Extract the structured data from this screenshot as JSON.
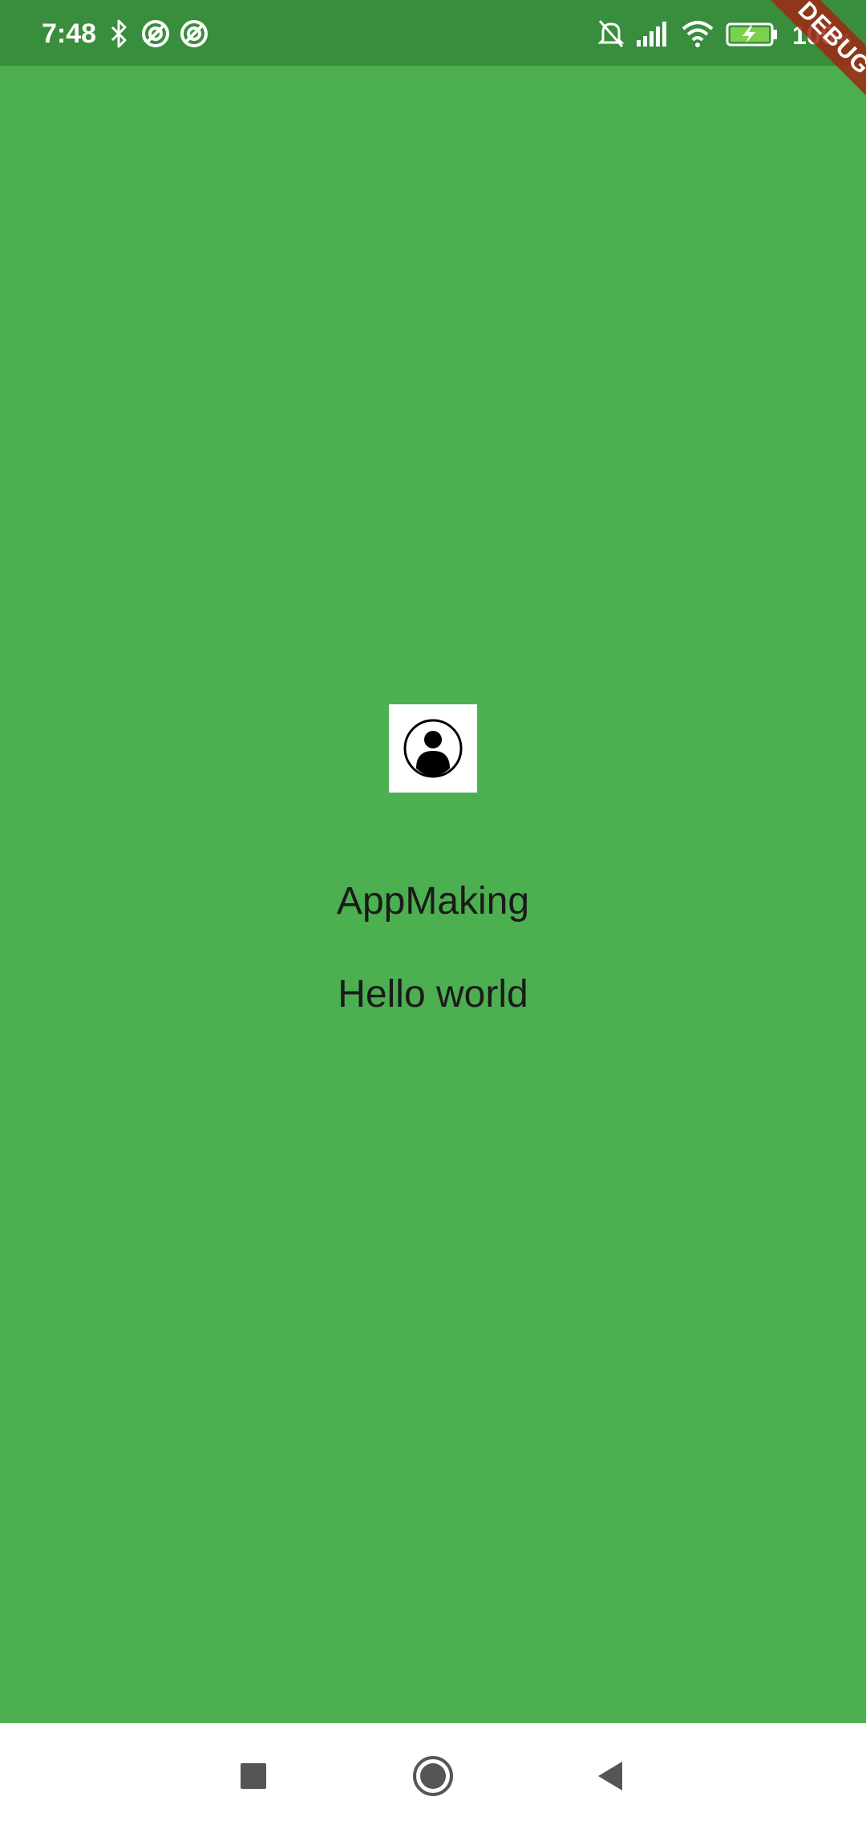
{
  "status_bar": {
    "time": "7:48",
    "battery_percent": "100",
    "battery_percent_sign": "%",
    "icons": [
      "bluetooth-icon",
      "sync-icon",
      "sync-icon",
      "bell-off-icon",
      "signal-icon",
      "wifi-icon",
      "battery-charging-icon"
    ]
  },
  "debug_banner": {
    "label": "DEBUG"
  },
  "main": {
    "avatar_icon": "account-circle-icon",
    "title": "AppMaking",
    "subtitle": "Hello world"
  },
  "nav_bar": {
    "buttons": [
      "recents-button",
      "home-button",
      "back-button"
    ]
  },
  "colors": {
    "background": "#4CAF50",
    "status_bar": "#388E3C",
    "debug_ribbon": "#A02814",
    "nav_bar": "#FFFFFF",
    "text": "#1A1A1A"
  }
}
